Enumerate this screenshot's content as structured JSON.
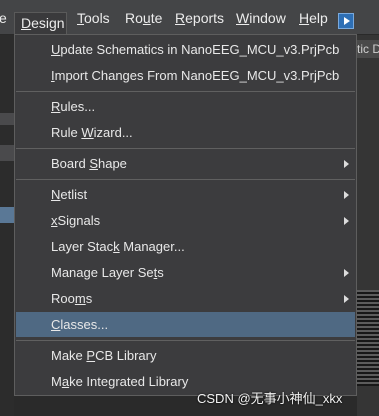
{
  "menubar": {
    "items": [
      {
        "pre": "",
        "ul": "",
        "post": "e"
      },
      {
        "pre": "",
        "ul": "D",
        "post": "esign"
      },
      {
        "pre": "",
        "ul": "T",
        "post": "ools"
      },
      {
        "pre": "Ro",
        "ul": "u",
        "post": "te"
      },
      {
        "pre": "",
        "ul": "R",
        "post": "eports"
      },
      {
        "pre": "",
        "ul": "W",
        "post": "indow"
      },
      {
        "pre": "",
        "ul": "H",
        "post": "elp"
      }
    ]
  },
  "dropdown": {
    "items": [
      {
        "pre": "",
        "ul": "U",
        "post": "pdate Schematics in NanoEEG_MCU_v3.PrjPcb"
      },
      {
        "pre": "",
        "ul": "I",
        "post": "mport Changes From NanoEEG_MCU_v3.PrjPcb"
      },
      {
        "pre": "",
        "ul": "R",
        "post": "ules..."
      },
      {
        "pre": "Rule ",
        "ul": "W",
        "post": "izard..."
      },
      {
        "pre": "Board ",
        "ul": "S",
        "post": "hape"
      },
      {
        "pre": "",
        "ul": "N",
        "post": "etlist"
      },
      {
        "pre": "",
        "ul": "x",
        "post": "Signals"
      },
      {
        "pre": "Layer Stac",
        "ul": "k",
        "post": " Manager..."
      },
      {
        "pre": "Manage Layer Se",
        "ul": "t",
        "post": "s"
      },
      {
        "pre": "Roo",
        "ul": "m",
        "post": "s"
      },
      {
        "pre": "",
        "ul": "C",
        "post": "lasses..."
      },
      {
        "pre": "Make ",
        "ul": "P",
        "post": "CB Library"
      },
      {
        "pre": "M",
        "ul": "a",
        "post": "ke Integrated Library"
      }
    ]
  },
  "background": {
    "right_tab": "tic D"
  },
  "watermark": "CSDN @无事小神仙_xkx"
}
